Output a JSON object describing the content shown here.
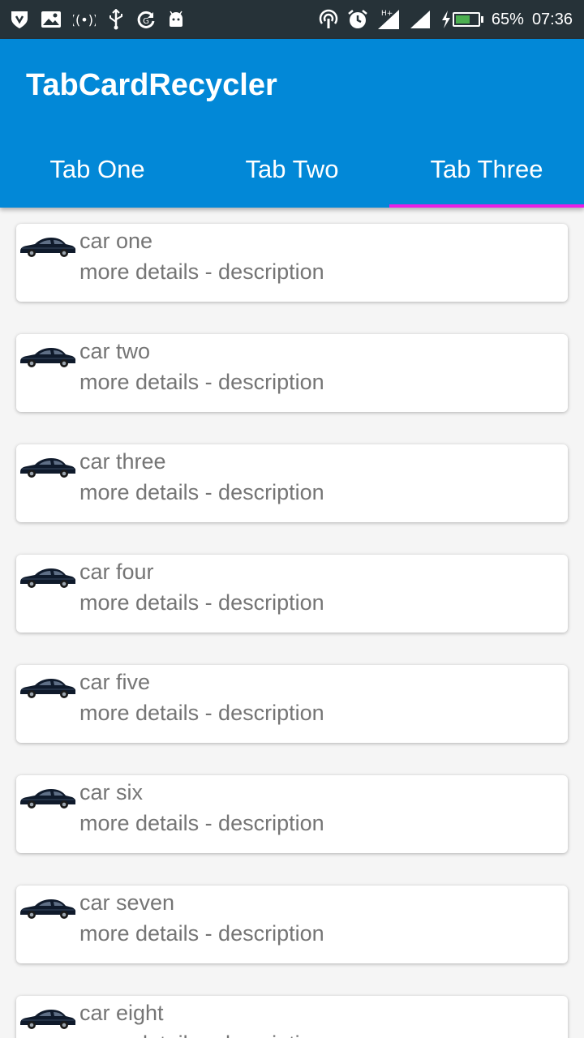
{
  "status_bar": {
    "battery_percent": 65,
    "battery_text": "65%",
    "time": "07:36"
  },
  "app_bar": {
    "title": "TabCardRecycler",
    "background_color": "#0288d7",
    "indicator_color": "#e91ee6"
  },
  "tabs": [
    {
      "label": "Tab One",
      "selected": false
    },
    {
      "label": "Tab Two",
      "selected": false
    },
    {
      "label": "Tab Three",
      "selected": true
    }
  ],
  "cards": [
    {
      "title": "car one",
      "description": "more details - description",
      "icon": "car-icon"
    },
    {
      "title": "car two",
      "description": "more details - description",
      "icon": "car-icon"
    },
    {
      "title": "car three",
      "description": "more details - description",
      "icon": "car-icon"
    },
    {
      "title": "car four",
      "description": "more details - description",
      "icon": "car-icon"
    },
    {
      "title": "car five",
      "description": "more details - description",
      "icon": "car-icon"
    },
    {
      "title": "car six",
      "description": "more details - description",
      "icon": "car-icon"
    },
    {
      "title": "car seven",
      "description": "more details - description",
      "icon": "car-icon"
    },
    {
      "title": "car eight",
      "description": "more details - description",
      "icon": "car-icon"
    }
  ]
}
